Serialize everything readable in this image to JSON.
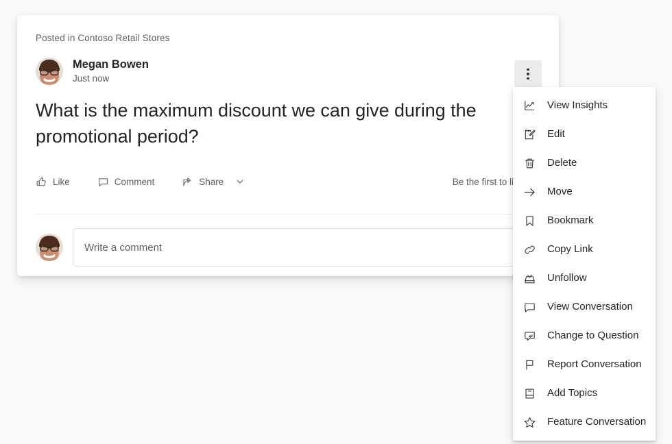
{
  "post": {
    "posted_in": "Posted in Contoso Retail Stores",
    "author_name": "Megan Bowen",
    "timestamp": "Just now",
    "body": "What is the maximum discount we can give during the promotional period?",
    "like_label": "Like",
    "comment_label": "Comment",
    "share_label": "Share",
    "reaction_hint": "Be the first to like this",
    "comment_placeholder": "Write a comment",
    "comment_value": ""
  },
  "overflow_menu": {
    "button_label": "More options",
    "items": [
      {
        "label": "View Insights",
        "icon": "insights-icon"
      },
      {
        "label": "Edit",
        "icon": "edit-icon"
      },
      {
        "label": "Delete",
        "icon": "delete-icon"
      },
      {
        "label": "Move",
        "icon": "arrow-right-icon"
      },
      {
        "label": "Bookmark",
        "icon": "bookmark-icon"
      },
      {
        "label": "Copy Link",
        "icon": "link-icon"
      },
      {
        "label": "Unfollow",
        "icon": "unfollow-icon"
      },
      {
        "label": "View Conversation",
        "icon": "conversation-icon"
      },
      {
        "label": "Change to Question",
        "icon": "change-to-question-icon"
      },
      {
        "label": "Report Conversation",
        "icon": "flag-icon"
      },
      {
        "label": "Add Topics",
        "icon": "add-topics-icon"
      },
      {
        "label": "Feature Conversation",
        "icon": "star-icon"
      }
    ]
  },
  "colors": {
    "page_background": "#faf9f8",
    "card_background": "#ffffff",
    "text_primary": "#252423",
    "text_secondary": "#605e5c",
    "divider": "#edebe9",
    "kebab_active_background": "#ebebeb"
  }
}
